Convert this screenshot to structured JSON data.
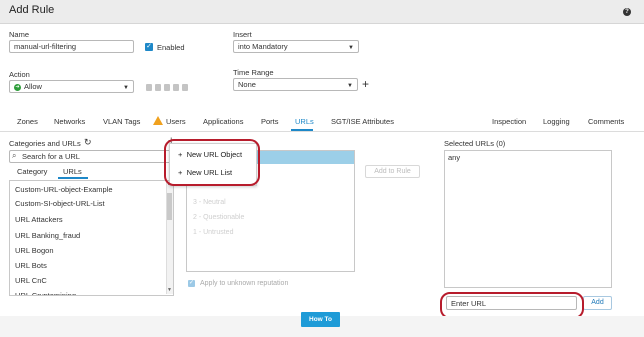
{
  "header": {
    "title": "Add Rule",
    "help_icon": "?"
  },
  "form": {
    "name_label": "Name",
    "name_value": "manual-url-filtering",
    "enabled_label": "Enabled",
    "insert_label": "Insert",
    "insert_value": "into Mandatory",
    "action_label": "Action",
    "action_value": "Allow",
    "time_range_label": "Time Range",
    "time_range_value": "None",
    "add_time_range": "+"
  },
  "tabs": [
    "Zones",
    "Networks",
    "VLAN Tags",
    "Users",
    "Applications",
    "Ports",
    "URLs",
    "SGT/ISE Attributes",
    "Inspection",
    "Logging",
    "Comments"
  ],
  "active_tab": "URLs",
  "categories": {
    "heading": "Categories and URLs",
    "add_icon": "+",
    "search_placeholder": "Search for a URL",
    "subtab_category": "Category",
    "subtab_urls": "URLs",
    "items": [
      "Custom-URL-object-Example",
      "Custom-SI-object-URL-List",
      "URL Attackers",
      "URL Banking_fraud",
      "URL Bogon",
      "URL Bots",
      "URL CnC",
      "URL Cryptomining"
    ]
  },
  "dropdown": {
    "items": [
      {
        "icon": "+",
        "label": "New URL Object"
      },
      {
        "icon": "+",
        "label": "New URL List"
      }
    ]
  },
  "reputation": {
    "items": [
      "3 - Neutral",
      "2 - Questionable",
      "1 - Untrusted"
    ],
    "apply_unknown": "Apply to unknown reputation",
    "add_to_rule": "Add to Rule"
  },
  "selected": {
    "heading": "Selected URLs (0)",
    "value": "any",
    "enter_url_value": "Enter URL",
    "add_button": "Add"
  },
  "footer": {
    "howto": "How To"
  },
  "colors": {
    "accent": "#1e88c8",
    "highlight_ring": "#b71c2c",
    "warning": "#f0a11e",
    "allow": "#2e9e3a"
  }
}
